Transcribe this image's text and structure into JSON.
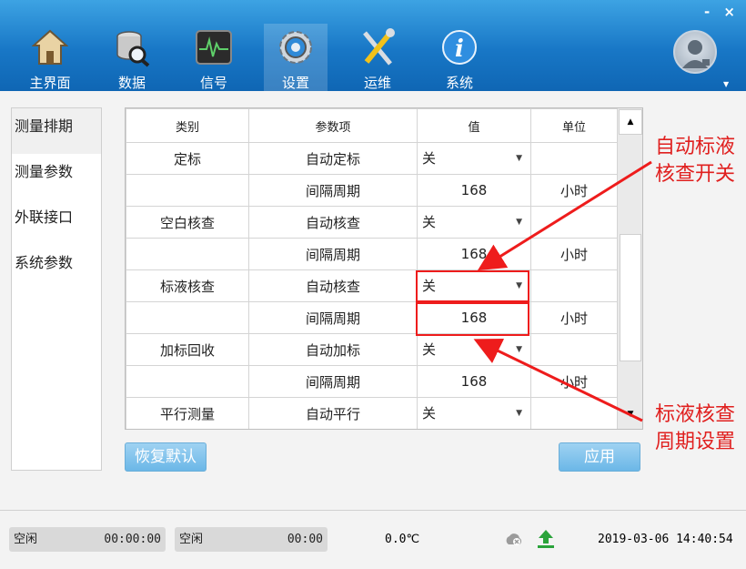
{
  "window": {
    "minimize_label": "-",
    "close_label": "×"
  },
  "nav": [
    {
      "label": "主界面",
      "icon": "home-icon"
    },
    {
      "label": "数据",
      "icon": "database-search-icon"
    },
    {
      "label": "信号",
      "icon": "signal-monitor-icon"
    },
    {
      "label": "设置",
      "icon": "gear-icon",
      "active": true
    },
    {
      "label": "运维",
      "icon": "tools-icon"
    },
    {
      "label": "系统",
      "icon": "info-icon"
    }
  ],
  "user": {
    "icon": "user-avatar-icon"
  },
  "sidebar": {
    "items": [
      {
        "label": "测量排期",
        "active": true
      },
      {
        "label": "测量参数"
      },
      {
        "label": "外联接口"
      },
      {
        "label": "系统参数"
      }
    ]
  },
  "table": {
    "headers": [
      "类别",
      "参数项",
      "值",
      "单位"
    ],
    "rows": [
      {
        "category": "定标",
        "param": "自动定标",
        "value": "关",
        "unit": "",
        "type": "select"
      },
      {
        "category": "",
        "param": "间隔周期",
        "value": "168",
        "unit": "小时",
        "type": "number"
      },
      {
        "category": "空白核查",
        "param": "自动核查",
        "value": "关",
        "unit": "",
        "type": "select"
      },
      {
        "category": "",
        "param": "间隔周期",
        "value": "168",
        "unit": "小时",
        "type": "number"
      },
      {
        "category": "标液核查",
        "param": "自动核查",
        "value": "关",
        "unit": "",
        "type": "select"
      },
      {
        "category": "",
        "param": "间隔周期",
        "value": "168",
        "unit": "小时",
        "type": "number"
      },
      {
        "category": "加标回收",
        "param": "自动加标",
        "value": "关",
        "unit": "",
        "type": "select"
      },
      {
        "category": "",
        "param": "间隔周期",
        "value": "168",
        "unit": "小时",
        "type": "number"
      },
      {
        "category": "平行测量",
        "param": "自动平行",
        "value": "关",
        "unit": "",
        "type": "select"
      }
    ]
  },
  "buttons": {
    "restore": "恢复默认",
    "apply": "应用"
  },
  "annotations": {
    "toggle_note": [
      "自动标液",
      "核查开关"
    ],
    "period_note": [
      "标液核查",
      "周期设置"
    ],
    "color": "#ee1c1c"
  },
  "status": {
    "slot1": {
      "state": "空闲",
      "time": "00:00:00"
    },
    "slot2": {
      "state": "空闲",
      "time": "00:00"
    },
    "temperature": "0.0℃",
    "datetime": "2019-03-06 14:40:54"
  },
  "colors": {
    "header": "#1877c6",
    "button": "#6bb7e7",
    "accent_red": "#ee1c1c",
    "upload_green": "#2aa33a"
  }
}
